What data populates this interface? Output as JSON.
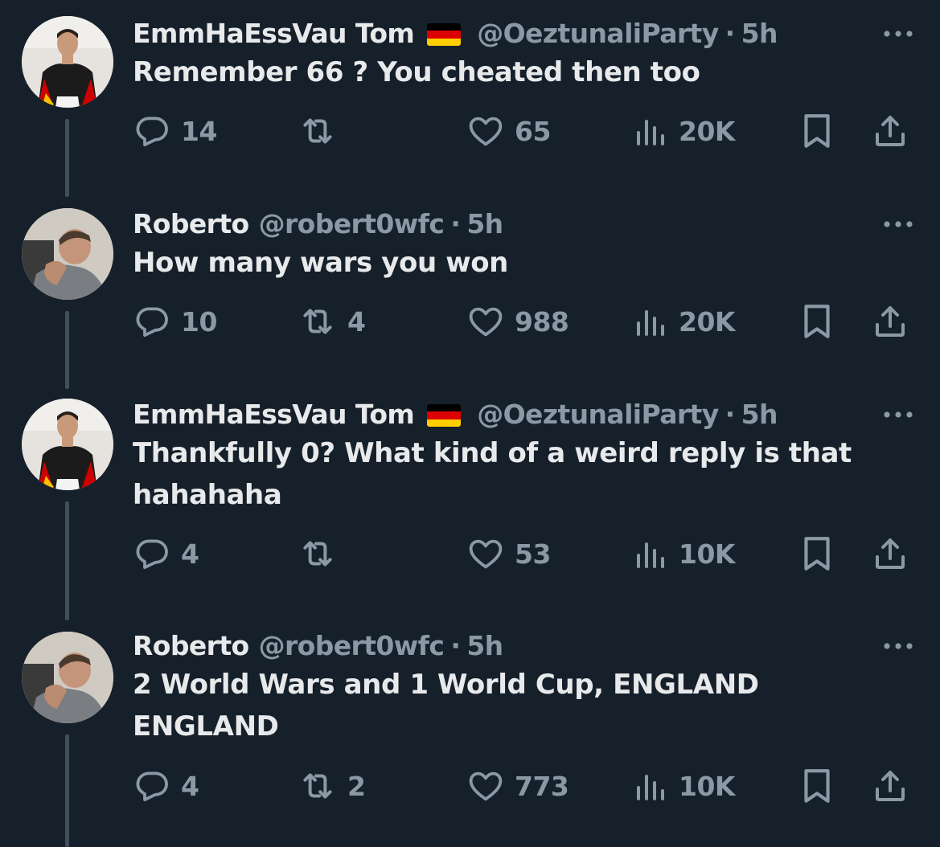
{
  "tweets": [
    {
      "author": "EmmHaEssVau Tom",
      "has_flag": true,
      "handle": "@OeztunaliParty",
      "time": "5h",
      "text": "Remember 66 ? You cheated then too",
      "replies": "14",
      "retweets": "",
      "likes": "65",
      "views": "20K"
    },
    {
      "author": "Roberto",
      "has_flag": false,
      "handle": "@robert0wfc",
      "time": "5h",
      "text": "How many wars you won",
      "replies": "10",
      "retweets": "4",
      "likes": "988",
      "views": "20K"
    },
    {
      "author": "EmmHaEssVau Tom",
      "has_flag": true,
      "handle": "@OeztunaliParty",
      "time": "5h",
      "text": "Thankfully 0? What kind of a weird reply is that hahahaha",
      "replies": "4",
      "retweets": "",
      "likes": "53",
      "views": "10K"
    },
    {
      "author": "Roberto",
      "has_flag": false,
      "handle": "@robert0wfc",
      "time": "5h",
      "text": "2 World Wars and 1 World Cup, ENGLAND ENGLAND",
      "replies": "4",
      "retweets": "2",
      "likes": "773",
      "views": "10K"
    }
  ],
  "separator": "·",
  "flag_colors": [
    "#000000",
    "#dd0000",
    "#ffce00"
  ],
  "icon_names": [
    "reply-icon",
    "retweet-icon",
    "like-icon",
    "views-icon",
    "bookmark-icon",
    "share-icon",
    "more-icon",
    "flag-de-icon"
  ],
  "colors": {
    "background": "#15202b",
    "primary_text": "#e7e9ea",
    "secondary_text": "#8b98a5",
    "thread_line": "#3f4e5c"
  }
}
